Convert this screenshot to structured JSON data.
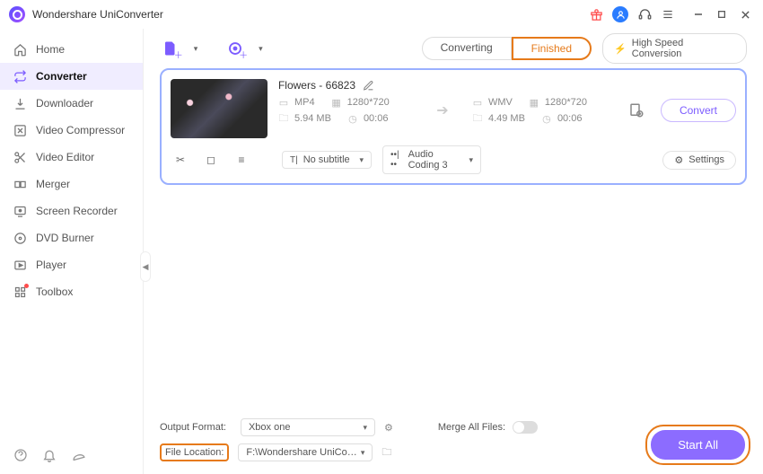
{
  "app": {
    "title": "Wondershare UniConverter"
  },
  "sidebar": {
    "items": [
      {
        "label": "Home"
      },
      {
        "label": "Converter"
      },
      {
        "label": "Downloader"
      },
      {
        "label": "Video Compressor"
      },
      {
        "label": "Video Editor"
      },
      {
        "label": "Merger"
      },
      {
        "label": "Screen Recorder"
      },
      {
        "label": "DVD Burner"
      },
      {
        "label": "Player"
      },
      {
        "label": "Toolbox"
      }
    ]
  },
  "topbar": {
    "tab_converting": "Converting",
    "tab_finished": "Finished",
    "high_speed": "High Speed Conversion"
  },
  "card": {
    "filename": "Flowers - 66823",
    "src": {
      "format": "MP4",
      "res": "1280*720",
      "size": "5.94 MB",
      "dur": "00:06"
    },
    "dst": {
      "format": "WMV",
      "res": "1280*720",
      "size": "4.49 MB",
      "dur": "00:06"
    },
    "convert_label": "Convert",
    "subtitle_value": "No subtitle",
    "audio_value": "Audio Coding 3",
    "settings_label": "Settings"
  },
  "bottom": {
    "output_format_label": "Output Format:",
    "output_format_value": "Xbox one",
    "file_location_label": "File Location:",
    "file_location_value": "F:\\Wondershare UniConverter",
    "merge_label": "Merge All Files:",
    "start_all": "Start All"
  }
}
